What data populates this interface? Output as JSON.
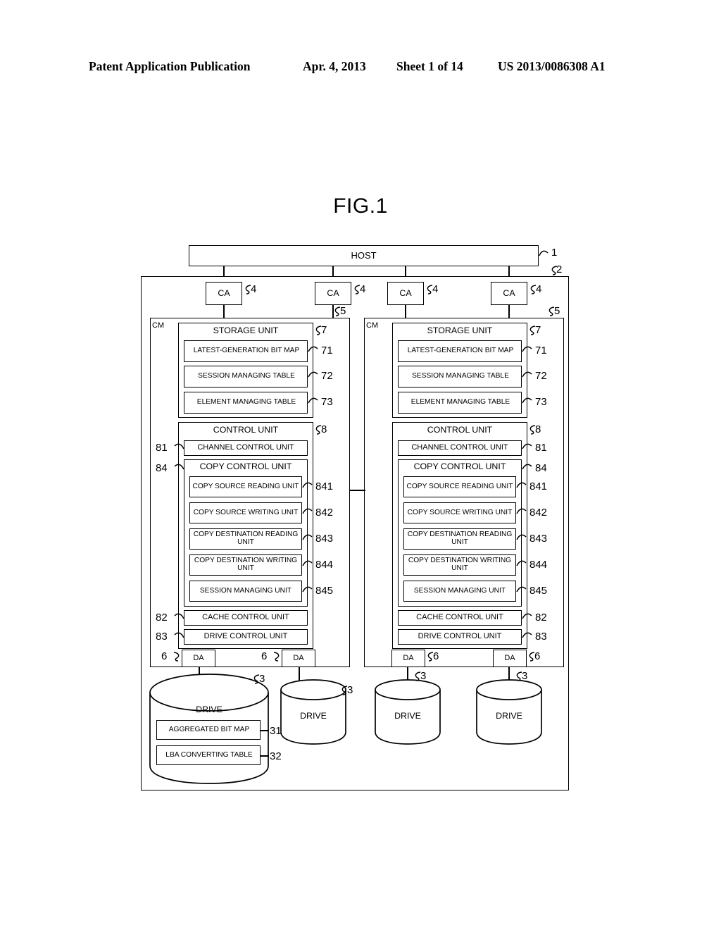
{
  "header": {
    "publication": "Patent Application Publication",
    "date": "Apr. 4, 2013",
    "sheet": "Sheet 1 of 14",
    "number": "US 2013/0086308 A1"
  },
  "figure": {
    "title": "FIG.1"
  },
  "diagram": {
    "host": {
      "label": "HOST",
      "ref": "1"
    },
    "system": {
      "ref": "2"
    },
    "channel_adapters": [
      {
        "label": "CA",
        "ref": "4"
      },
      {
        "label": "CA",
        "ref": "4"
      },
      {
        "label": "CA",
        "ref": "4"
      },
      {
        "label": "CA",
        "ref": "4"
      }
    ],
    "controller_modules": [
      {
        "label": "CM",
        "ref": "5",
        "storage_unit": {
          "label": "STORAGE UNIT",
          "ref": "7",
          "items": [
            {
              "label": "LATEST-GENERATION BIT MAP",
              "ref": "71"
            },
            {
              "label": "SESSION MANAGING TABLE",
              "ref": "72"
            },
            {
              "label": "ELEMENT MANAGING TABLE",
              "ref": "73"
            }
          ]
        },
        "control_unit": {
          "label": "CONTROL UNIT",
          "ref": "8",
          "channel_control_unit": {
            "label": "CHANNEL CONTROL UNIT",
            "ref": "81"
          },
          "copy_control_unit": {
            "label": "COPY CONTROL UNIT",
            "ref": "84",
            "items": [
              {
                "label": "COPY SOURCE READING UNIT",
                "ref": "841"
              },
              {
                "label": "COPY SOURCE WRITING UNIT",
                "ref": "842"
              },
              {
                "label": "COPY DESTINATION READING UNIT",
                "ref": "843"
              },
              {
                "label": "COPY DESTINATION WRITING UNIT",
                "ref": "844"
              },
              {
                "label": "SESSION MANAGING UNIT",
                "ref": "845"
              }
            ]
          },
          "cache_control_unit": {
            "label": "CACHE CONTROL UNIT",
            "ref": "82"
          },
          "drive_control_unit": {
            "label": "DRIVE CONTROL UNIT",
            "ref": "83"
          }
        },
        "device_adapters": [
          {
            "label": "DA",
            "ref": "6"
          },
          {
            "label": "DA",
            "ref": "6"
          }
        ]
      },
      {
        "label": "CM",
        "ref": "5",
        "storage_unit": {
          "label": "STORAGE UNIT",
          "ref": "7",
          "items": [
            {
              "label": "LATEST-GENERATION BIT MAP",
              "ref": "71"
            },
            {
              "label": "SESSION MANAGING TABLE",
              "ref": "72"
            },
            {
              "label": "ELEMENT MANAGING TABLE",
              "ref": "73"
            }
          ]
        },
        "control_unit": {
          "label": "CONTROL UNIT",
          "ref": "8",
          "channel_control_unit": {
            "label": "CHANNEL CONTROL UNIT",
            "ref": "81"
          },
          "copy_control_unit": {
            "label": "COPY CONTROL UNIT",
            "ref": "84",
            "items": [
              {
                "label": "COPY SOURCE READING UNIT",
                "ref": "841"
              },
              {
                "label": "COPY SOURCE WRITING UNIT",
                "ref": "842"
              },
              {
                "label": "COPY DESTINATION READING UNIT",
                "ref": "843"
              },
              {
                "label": "COPY DESTINATION WRITING UNIT",
                "ref": "844"
              },
              {
                "label": "SESSION MANAGING UNIT",
                "ref": "845"
              }
            ]
          },
          "cache_control_unit": {
            "label": "CACHE CONTROL UNIT",
            "ref": "82"
          },
          "drive_control_unit": {
            "label": "DRIVE CONTROL UNIT",
            "ref": "83"
          }
        },
        "device_adapters": [
          {
            "label": "DA",
            "ref": "6"
          },
          {
            "label": "DA",
            "ref": "6"
          }
        ]
      }
    ],
    "drives": [
      {
        "label": "DRIVE",
        "ref": "3",
        "items": [
          {
            "label": "AGGREGATED BIT MAP",
            "ref": "31"
          },
          {
            "label": "LBA CONVERTING TABLE",
            "ref": "32"
          }
        ]
      },
      {
        "label": "DRIVE",
        "ref": "3",
        "items": []
      },
      {
        "label": "DRIVE",
        "ref": "3",
        "items": []
      },
      {
        "label": "DRIVE",
        "ref": "3",
        "items": []
      }
    ]
  }
}
